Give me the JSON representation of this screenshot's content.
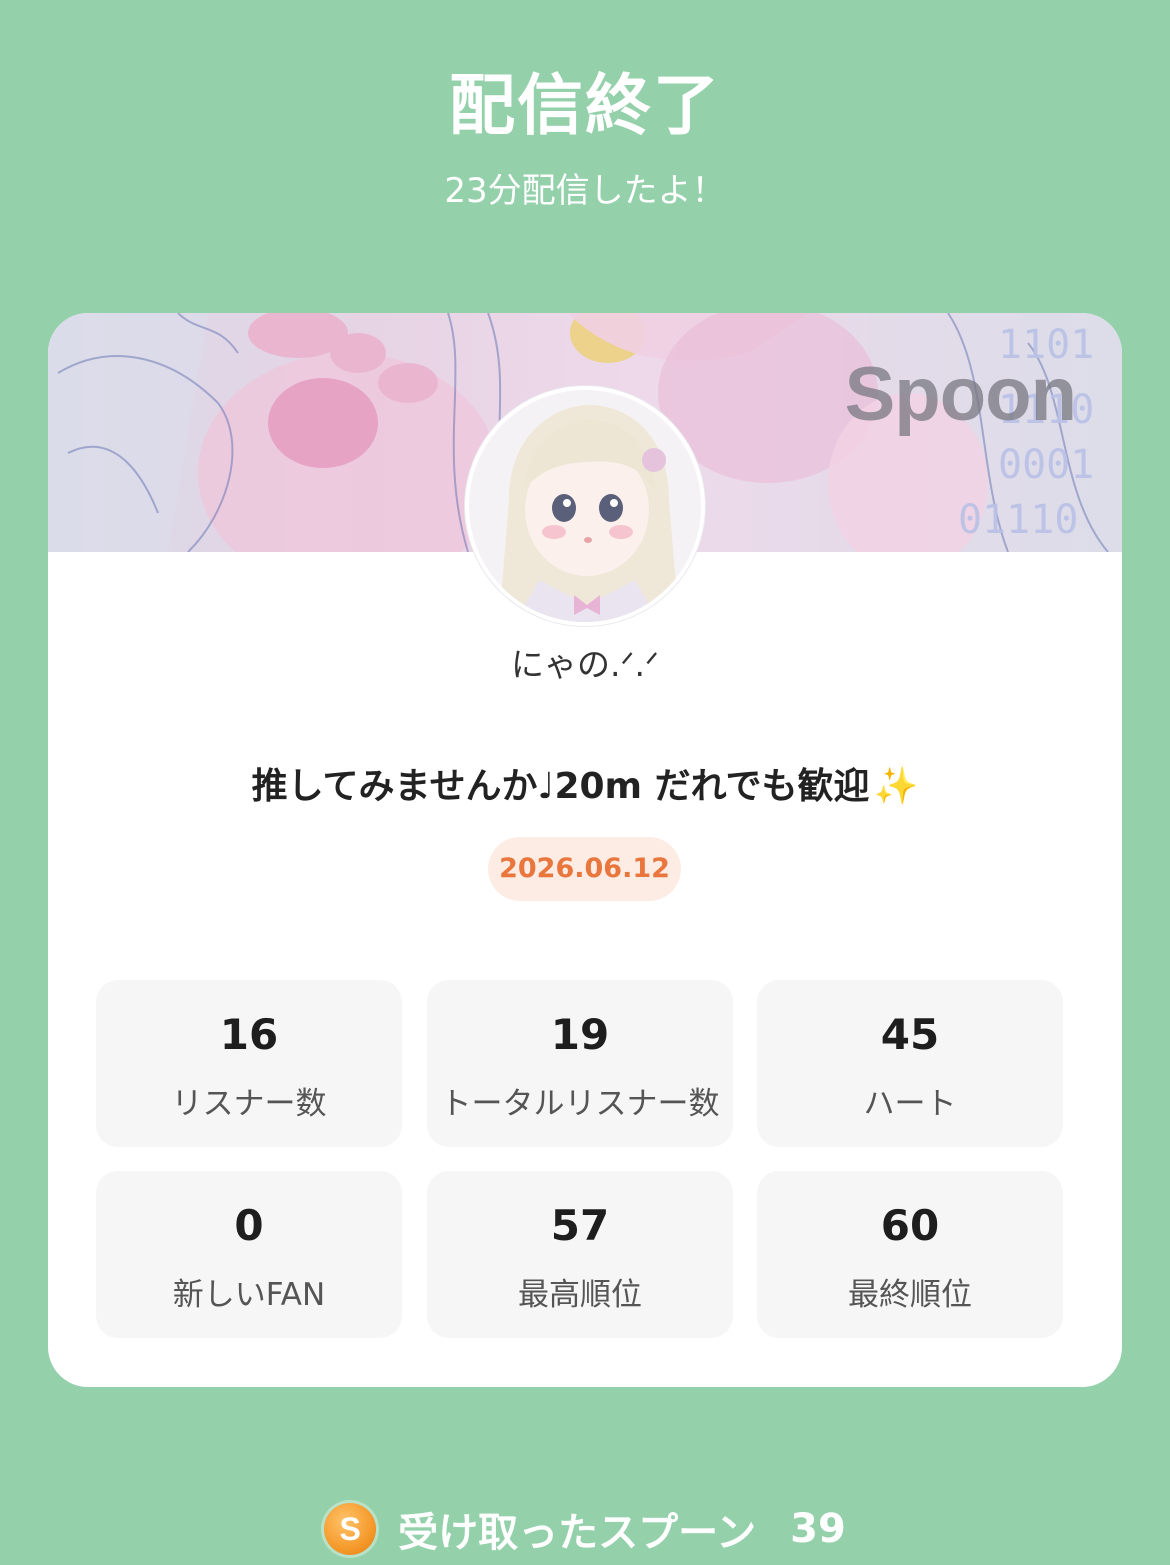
{
  "header": {
    "title": "配信終了",
    "subtitle": "23分配信したよ！"
  },
  "card": {
    "watermark": "Spoon",
    "username": "にゃの.ᐟ.ᐟ",
    "live_title": "推してみませんか♩20m だれでも歓迎",
    "live_title_emoji": "✨",
    "date": "2026.06.12",
    "stats": [
      {
        "value": "16",
        "label": "リスナー数"
      },
      {
        "value": "19",
        "label": "トータルリスナー数"
      },
      {
        "value": "45",
        "label": "ハート"
      },
      {
        "value": "0",
        "label": "新しいFAN"
      },
      {
        "value": "57",
        "label": "最高順位"
      },
      {
        "value": "60",
        "label": "最終順位"
      }
    ]
  },
  "footer": {
    "icon_letter": "S",
    "label": "受け取ったスプーン",
    "count": "39"
  },
  "colors": {
    "background": "#94d1ab",
    "date_text": "#e8763d",
    "date_bg": "#fdece4",
    "stat_bg": "#f6f6f6"
  }
}
